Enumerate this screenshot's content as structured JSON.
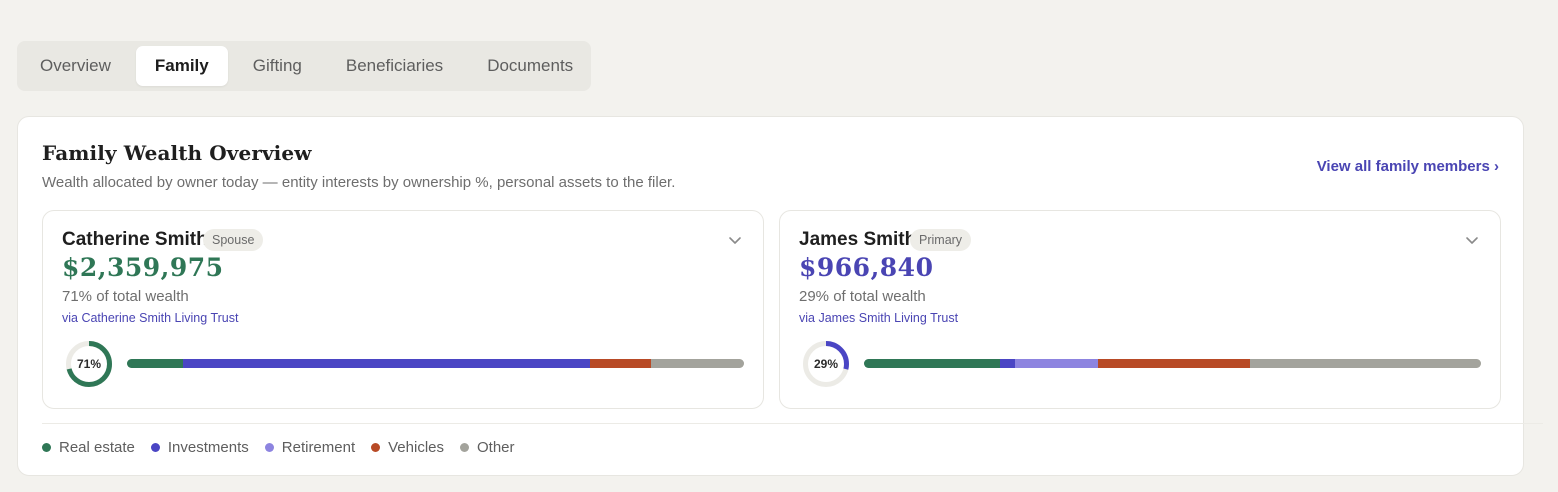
{
  "tabs": [
    {
      "label": "Overview",
      "active": false
    },
    {
      "label": "Family",
      "active": true
    },
    {
      "label": "Gifting",
      "active": false
    },
    {
      "label": "Beneficiaries",
      "active": false
    },
    {
      "label": "Documents",
      "active": false
    }
  ],
  "panel": {
    "title": "Family Wealth Overview",
    "subtitle": "Wealth allocated by owner today — entity interests by ownership %, personal assets to the filer.",
    "view_all_label": "View all family members ›"
  },
  "colors": {
    "real_estate": "#2f7756",
    "investments": "#4a45c4",
    "retirement": "#8d84e0",
    "vehicles": "#b84a26",
    "other": "#a3a39c",
    "primary_amount": "#4a45b3",
    "spouse_amount": "#2f7756"
  },
  "members": [
    {
      "name": "Catherine Smith",
      "badge": "Spouse",
      "amount": "$2,359,975",
      "amount_color": "#2f7756",
      "share_text": "71% of total wealth",
      "via_text": "via Catherine Smith Living Trust",
      "share_pct": 71,
      "share_label": "71%",
      "donut_color": "#2f7756",
      "allocation": [
        {
          "category": "Real estate",
          "pct": 9,
          "color": "#2f7756"
        },
        {
          "category": "Investments",
          "pct": 66,
          "color": "#4a45c4"
        },
        {
          "category": "Vehicles",
          "pct": 10,
          "color": "#b84a26"
        },
        {
          "category": "Other",
          "pct": 15,
          "color": "#a3a39c"
        }
      ]
    },
    {
      "name": "James Smith",
      "badge": "Primary",
      "amount": "$966,840",
      "amount_color": "#4a45b3",
      "share_text": "29% of total wealth",
      "via_text": "via James Smith Living Trust",
      "share_pct": 29,
      "share_label": "29%",
      "donut_color": "#4a45c4",
      "allocation": [
        {
          "category": "Real estate",
          "pct": 22,
          "color": "#2f7756"
        },
        {
          "category": "Investments",
          "pct": 2.5,
          "color": "#4a45c4"
        },
        {
          "category": "Retirement",
          "pct": 13.5,
          "color": "#8d84e0"
        },
        {
          "category": "Vehicles",
          "pct": 24.5,
          "color": "#b84a26"
        },
        {
          "category": "Other",
          "pct": 37.5,
          "color": "#a3a39c"
        }
      ]
    }
  ],
  "legend": [
    {
      "label": "Real estate",
      "color": "#2f7756"
    },
    {
      "label": "Investments",
      "color": "#4a45c4"
    },
    {
      "label": "Retirement",
      "color": "#8d84e0"
    },
    {
      "label": "Vehicles",
      "color": "#b84a26"
    },
    {
      "label": "Other",
      "color": "#a3a39c"
    }
  ]
}
